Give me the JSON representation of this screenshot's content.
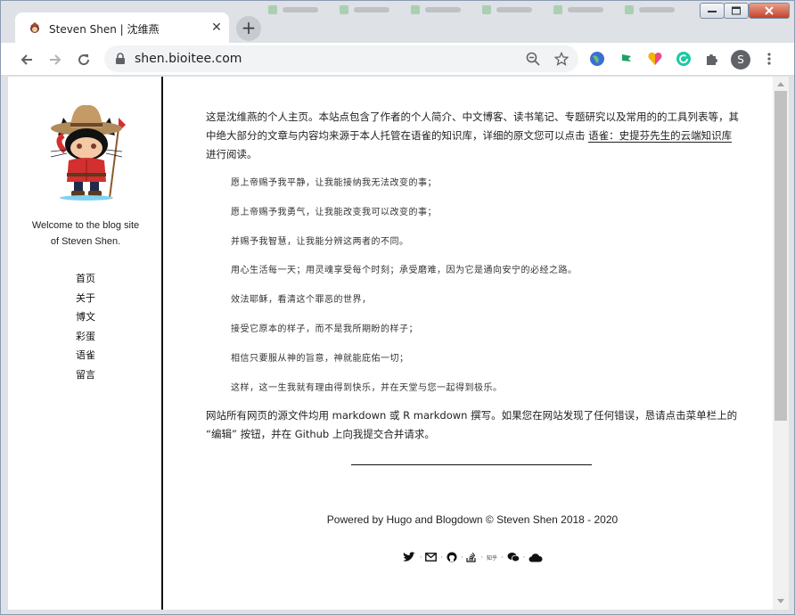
{
  "browser": {
    "tab_title": "Steven Shen | 沈维燕",
    "url": "shen.bioitee.com",
    "profile_initial": "S",
    "accent": "#4285f4"
  },
  "sidebar": {
    "welcome_line1": "Welcome to the blog site",
    "welcome_line2": "of Steven Shen.",
    "nav": [
      {
        "label": "首页"
      },
      {
        "label": "关于"
      },
      {
        "label": "博文"
      },
      {
        "label": "彩蛋"
      },
      {
        "label": "语雀"
      },
      {
        "label": "留言"
      }
    ]
  },
  "main": {
    "intro_text": "这是沈维燕的个人主页。本站点包含了作者的个人简介、中文博客、读书笔记、专题研究以及常用的的工具列表等，其中绝大部分的文章与内容均来源于本人托管在语雀的知识库，详细的原文您可以点击 ",
    "intro_link": "语雀：史提芬先生的云端知识库",
    "intro_tail": " 进行阅读。",
    "quotes": [
      "愿上帝赐予我平静，让我能接纳我无法改变的事；",
      "愿上帝赐予我勇气，让我能改变我可以改变的事；",
      "并赐予我智慧，让我能分辨这两者的不同。",
      "用心生活每一天；用灵魂享受每个时刻；承受磨难，因为它是通向安宁的必经之路。",
      "效法耶稣，看清这个罪恶的世界，",
      "接受它原本的样子，而不是我所期盼的样子；",
      "相信只要服从神的旨意，神就能庇佑一切；",
      "这样，这一生我就有理由得到快乐，并在天堂与您一起得到极乐。"
    ],
    "outro_text": "网站所有网页的源文件均用 markdown 或 R markdown 撰写。如果您在网站发现了任何错误，恳请点击菜单栏上的 “编辑” 按钮，并在 Github 上向我提交合并请求。",
    "footer": "Powered by Hugo and Blogdown © Steven Shen 2018 - 2020",
    "social_zhihu": "知乎"
  }
}
